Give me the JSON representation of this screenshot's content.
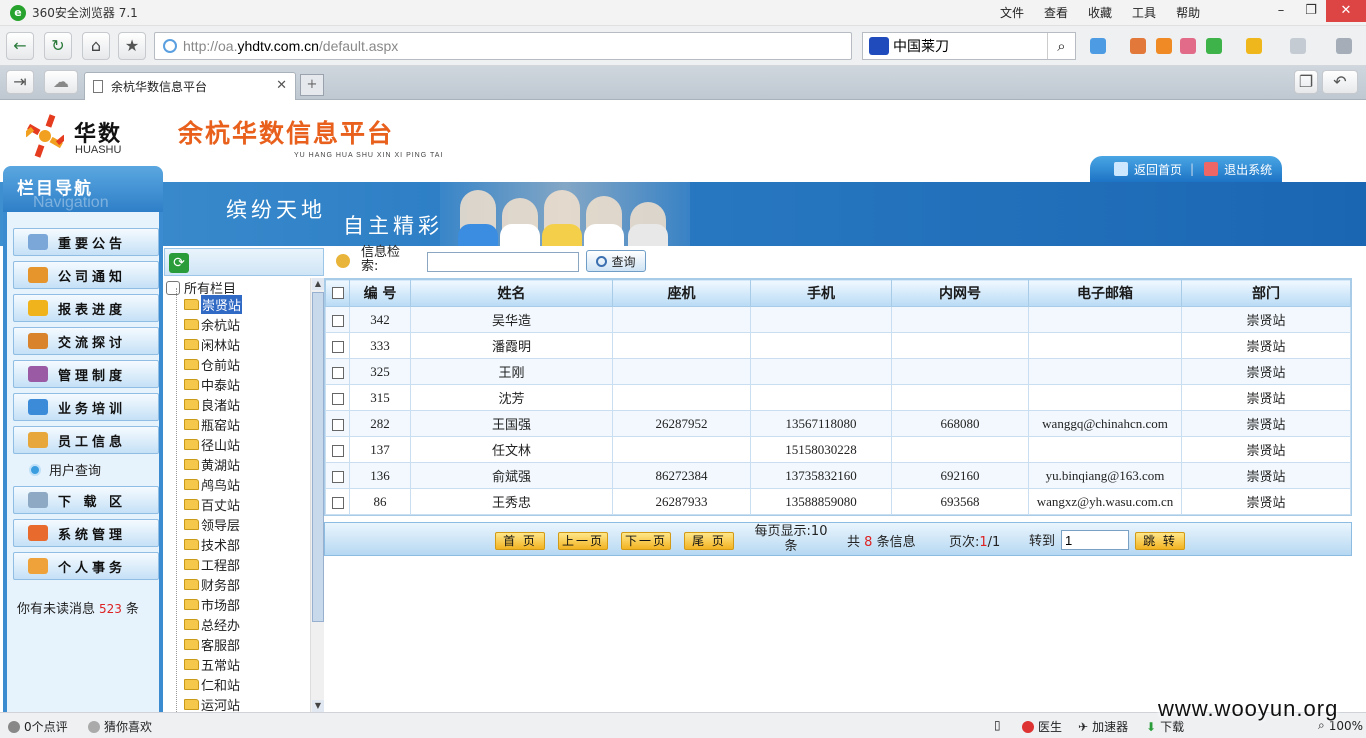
{
  "browser": {
    "app_title": "360安全浏览器 7.1",
    "menu": [
      "文件",
      "查看",
      "收藏",
      "工具",
      "帮助"
    ],
    "url_prefix": "http://oa.",
    "url_host": "yhdtv.com.cn",
    "url_path": "/default.aspx",
    "search_query": "中国莱刀",
    "tab_title": "余杭华数信息平台",
    "status": {
      "clicks": "0个点评",
      "guess": "猜你喜欢",
      "doctor": "医生",
      "accel": "加速器",
      "download": "下载",
      "zoom": "100%"
    }
  },
  "header": {
    "logo_cn": "华数",
    "logo_en": "HUASHU",
    "site_title": "余杭华数信息平台",
    "site_pinyin": "YU HANG HUA SHU XIN XI PING TAI",
    "home_link": "返回首页",
    "logout_link": "退出系统"
  },
  "banner": {
    "slogan1": "缤纷天地",
    "slogan2": "自主精彩"
  },
  "leftnav": {
    "title": "栏目导航",
    "title_en": "Navigation",
    "items": [
      "重要公告",
      "公司通知",
      "报表进度",
      "交流探讨",
      "管理制度",
      "业务培训",
      "员工信息"
    ],
    "sub_item": "用户查询",
    "items2": [
      "下 载 区",
      "系统管理",
      "个人事务"
    ],
    "unread_prefix": "你有未读消息",
    "unread_count": "523",
    "unread_suffix": "条"
  },
  "tree": {
    "root": "所有栏目",
    "nodes": [
      "崇贤站",
      "余杭站",
      "闲林站",
      "仓前站",
      "中泰站",
      "良渚站",
      "瓶窑站",
      "径山站",
      "黄湖站",
      "鸬鸟站",
      "百丈站",
      "领导层",
      "技术部",
      "工程部",
      "财务部",
      "市场部",
      "总经办",
      "客服部",
      "五常站",
      "仁和站",
      "运河站"
    ]
  },
  "search": {
    "label": "信息检索:",
    "value": "",
    "button": "查询"
  },
  "table": {
    "columns": [
      "编 号",
      "姓名",
      "座机",
      "手机",
      "内网号",
      "电子邮箱",
      "部门"
    ],
    "rows": [
      {
        "id": "342",
        "name": "吴华造",
        "phone": "",
        "mobile": "",
        "intranet": "",
        "email": "",
        "dept": "崇贤站"
      },
      {
        "id": "333",
        "name": "潘霞明",
        "phone": "",
        "mobile": "",
        "intranet": "",
        "email": "",
        "dept": "崇贤站"
      },
      {
        "id": "325",
        "name": "王刚",
        "phone": "",
        "mobile": "",
        "intranet": "",
        "email": "",
        "dept": "崇贤站"
      },
      {
        "id": "315",
        "name": "沈芳",
        "phone": "",
        "mobile": "",
        "intranet": "",
        "email": "",
        "dept": "崇贤站"
      },
      {
        "id": "282",
        "name": "王国强",
        "phone": "26287952",
        "mobile": "13567118080",
        "intranet": "668080",
        "email": "wanggq@chinahcn.com",
        "dept": "崇贤站"
      },
      {
        "id": "137",
        "name": "任文林",
        "phone": "",
        "mobile": "15158030228",
        "intranet": "",
        "email": "",
        "dept": "崇贤站"
      },
      {
        "id": "136",
        "name": "俞斌强",
        "phone": "86272384",
        "mobile": "13735832160",
        "intranet": "692160",
        "email": "yu.binqiang@163.com",
        "dept": "崇贤站"
      },
      {
        "id": "86",
        "name": "王秀忠",
        "phone": "26287933",
        "mobile": "13588859080",
        "intranet": "693568",
        "email": "wangxz@yh.wasu.com.cn",
        "dept": "崇贤站"
      }
    ]
  },
  "pager": {
    "first": "首 页",
    "prev": "上一页",
    "next": "下一页",
    "last": "尾 页",
    "per_page_label": "每页显示:",
    "per_page": "10",
    "per_page_unit": "条",
    "total_prefix": "共",
    "total": "8",
    "total_suffix": "条信息",
    "page_label": "页次:",
    "page_current": "1",
    "page_total": "/1",
    "goto_label": "转到",
    "goto_value": "1",
    "goto_button": "跳 转"
  },
  "watermark": "www.wooyun.org"
}
